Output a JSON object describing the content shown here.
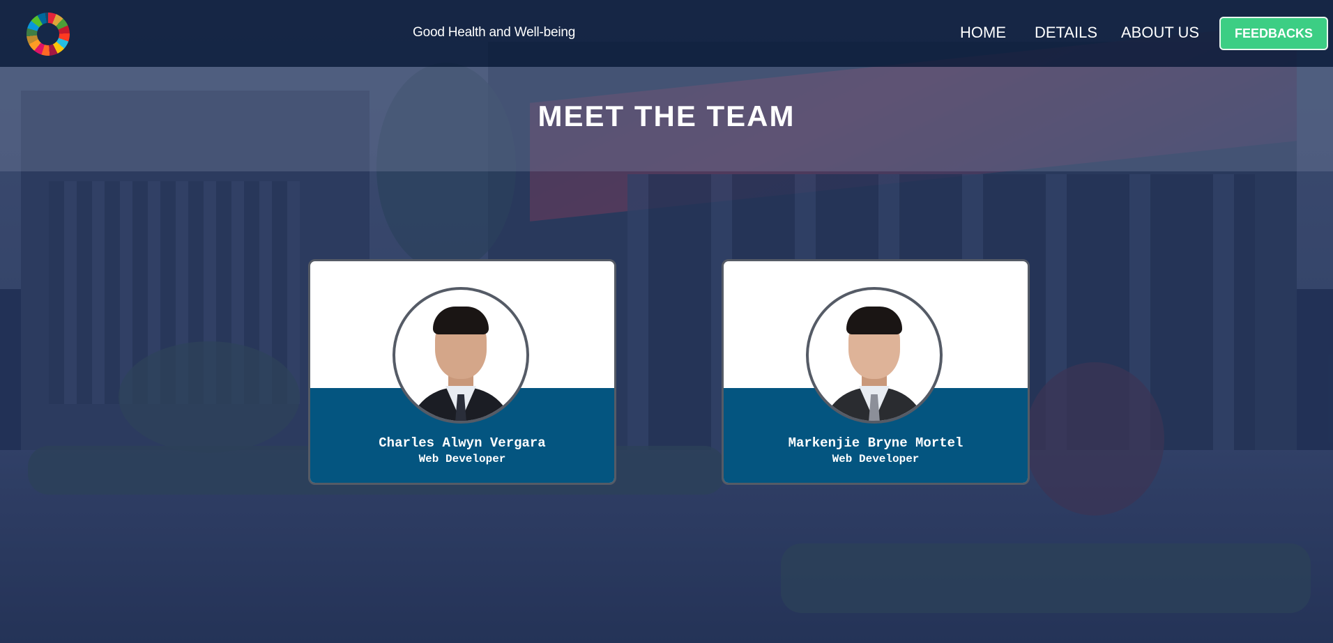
{
  "header": {
    "site_title": "Good Health and Well-being",
    "logo_icon": "sdg-wheel-icon",
    "nav": {
      "home": "HOME",
      "details": "DETAILS",
      "about": "ABOUT US",
      "feedbacks": "FEEDBACKS"
    },
    "feedbacks_color": "#3cce84"
  },
  "main": {
    "title": "MEET THE TEAM",
    "members": [
      {
        "name": "Charles Alwyn Vergara",
        "role": "Web Developer"
      },
      {
        "name": "Markenjie Bryne Mortel",
        "role": "Web Developer"
      }
    ],
    "card_accent": "#045580"
  }
}
